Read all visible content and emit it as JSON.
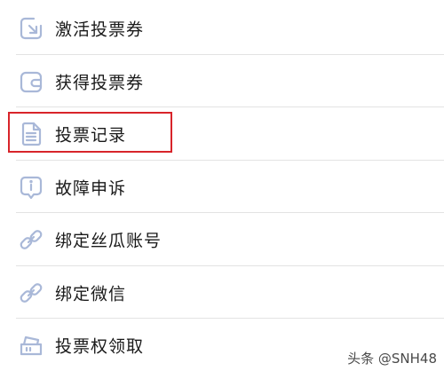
{
  "menu": {
    "items": [
      {
        "label": "激活投票券",
        "icon": "arrow-box-icon"
      },
      {
        "label": "获得投票券",
        "icon": "wallet-icon"
      },
      {
        "label": "投票记录",
        "icon": "document-icon",
        "highlighted": true
      },
      {
        "label": "故障申诉",
        "icon": "info-bubble-icon"
      },
      {
        "label": "绑定丝瓜账号",
        "icon": "link-icon"
      },
      {
        "label": "绑定微信",
        "icon": "link-icon"
      },
      {
        "label": "投票权领取",
        "icon": "ticket-icon"
      }
    ]
  },
  "highlight_color": "#d8242a",
  "icon_color": "#a9b8d8",
  "watermark": "头条 @SNH48"
}
